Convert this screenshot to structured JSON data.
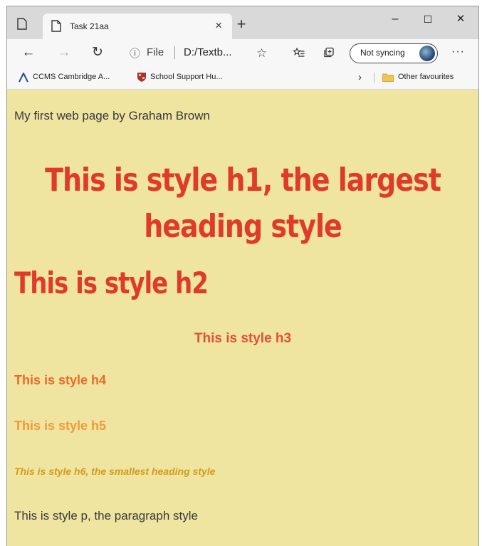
{
  "browser": {
    "tab": {
      "title": "Task 21aa",
      "close": "×"
    },
    "new_tab": "+",
    "window_controls": {
      "minimize": "–",
      "maximize": "☐",
      "close": "✕"
    },
    "nav": {
      "back": "←",
      "forward": "→",
      "refresh": "↻"
    },
    "address": {
      "info_icon": "ⓘ",
      "scheme_label": "File",
      "url": "D:/Textb..."
    },
    "favorite_star": "☆",
    "sync_label": "Not syncing",
    "more": "···",
    "favourites": [
      {
        "label": "CCMS Cambridge A...",
        "icon": "cambridge-a-icon"
      },
      {
        "label": "School Support Hu...",
        "icon": "shield-crest-icon"
      }
    ],
    "favourites_chevron": "›",
    "other_favourites": "Other favourites"
  },
  "page": {
    "intro": "My first web page by Graham Brown",
    "h1": "This is style h1, the largest heading style",
    "h2": "This is style h2",
    "h3": "This is style h3",
    "h4": "This is style h4",
    "h5": "This is style h5",
    "h6": "This is style h6, the smallest heading style",
    "paragraph": "This is style p, the paragraph style"
  },
  "colors": {
    "page_background": "#efe4a0",
    "h1": "#e03a2a",
    "h2": "#e03a2a",
    "h3": "#e2503a",
    "h4": "#ea6a2a",
    "h5": "#f09a3a",
    "h6": "#d49a1c"
  }
}
